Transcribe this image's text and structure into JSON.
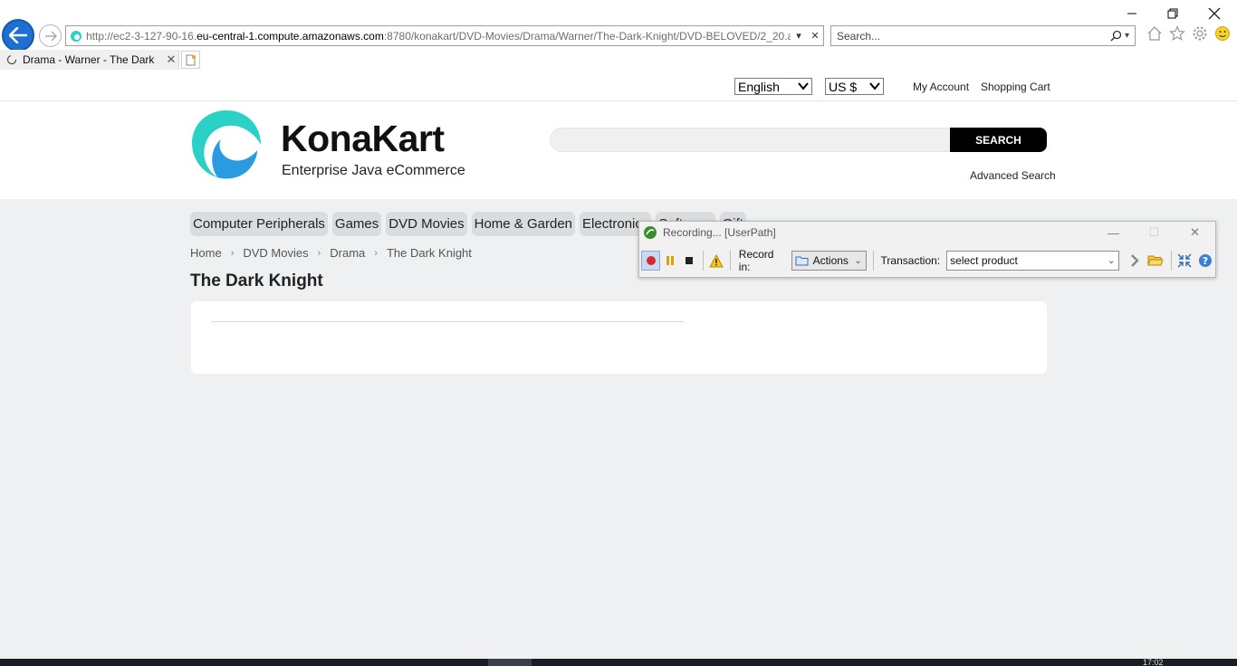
{
  "browser": {
    "url_prefix": "http://ec2-3-127-90-16.",
    "url_host": "eu-central-1.compute.amazonaws.com",
    "url_path": ":8780/konakart/DVD-Movies/Drama/Warner/The-Dark-Knight/DVD-BELOVED/2_20.a",
    "search_placeholder": "Search...",
    "tab_title": "Drama - Warner - The Dark ..."
  },
  "topbar": {
    "language": "English",
    "currency": "US $",
    "my_account": "My Account",
    "shopping_cart": "Shopping Cart"
  },
  "header": {
    "brand": "KonaKart",
    "tagline": "Enterprise Java eCommerce",
    "search_button": "SEARCH",
    "search_value": "",
    "advanced_search": "Advanced Search"
  },
  "nav": {
    "items": [
      "Computer Peripherals",
      "Games",
      "DVD Movies",
      "Home & Garden",
      "Electronics",
      "Software",
      "Gift"
    ]
  },
  "breadcrumb": {
    "items": [
      "Home",
      "DVD Movies",
      "Drama",
      "The Dark Knight"
    ]
  },
  "page": {
    "title": "The Dark Knight"
  },
  "recorder": {
    "title": "Recording... [UserPath]",
    "record_in_label": "Record in:",
    "record_in_value": "Actions",
    "transaction_label": "Transaction:",
    "transaction_value": "select product"
  },
  "taskbar": {
    "clock": "17:02"
  },
  "colors": {
    "logo_teal": "#2bd1c4",
    "logo_blue": "#2a9be0",
    "page_bg": "#eff0f1",
    "search_button_bg": "#000000",
    "back_button": "#1d6fd1"
  }
}
